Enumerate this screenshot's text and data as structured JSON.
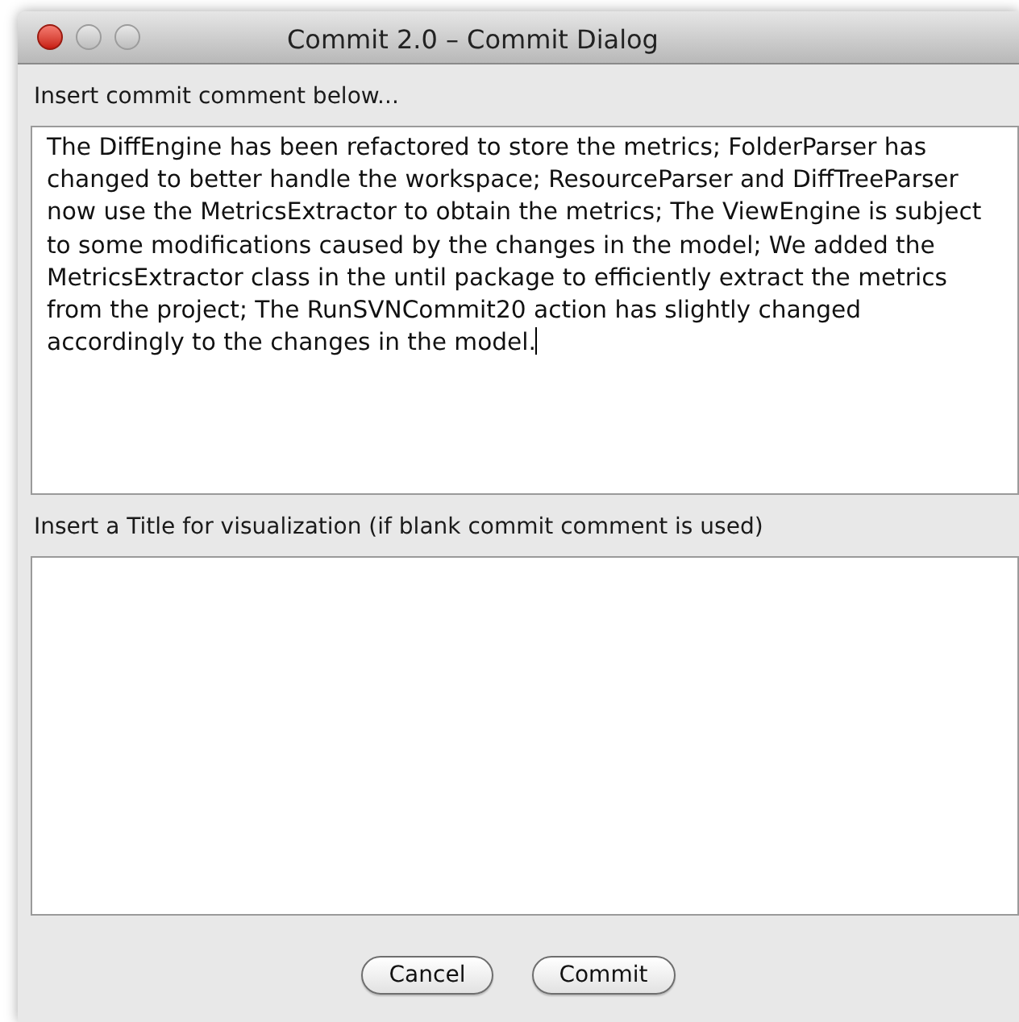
{
  "window": {
    "title": "Commit 2.0 – Commit Dialog"
  },
  "comment": {
    "label": "Insert commit comment below...",
    "value": "The DiffEngine has been refactored to store the metrics; FolderParser has changed to better handle the workspace; ResourceParser and DiffTreeParser now use the MetricsExtractor to obtain the metrics; The ViewEngine is subject to some modifications caused by the changes in the model; We added the MetricsExtractor class in the until package to efficiently extract the metrics from the project; The RunSVNCommit20 action has slightly changed accordingly to the changes in the model.",
    "focused": true
  },
  "title_field": {
    "label": "Insert a Title for visualization (if blank commit comment is used)"
  },
  "buttons": [
    {
      "label": "Cancel"
    },
    {
      "label": "Commit"
    }
  ]
}
